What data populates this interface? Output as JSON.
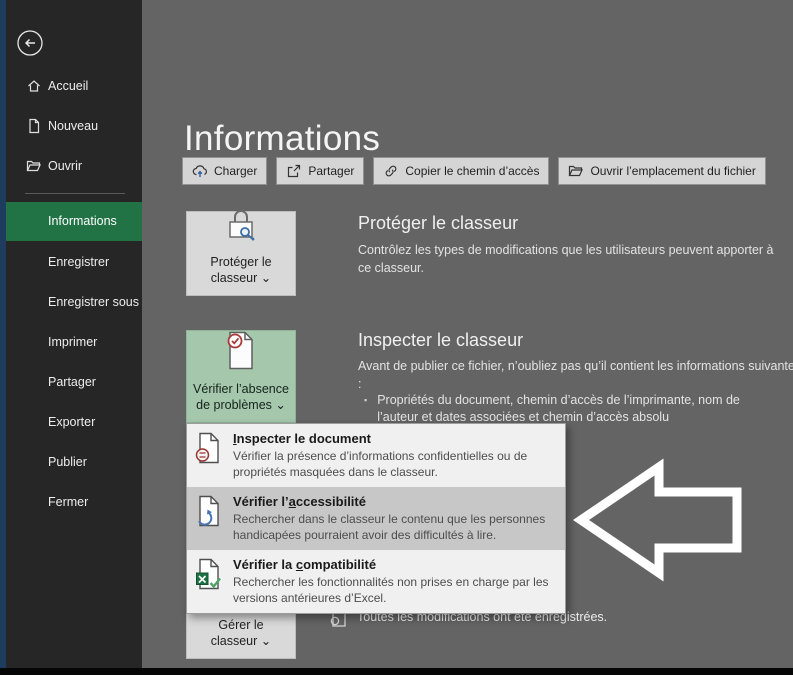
{
  "sidebar": {
    "top_items": [
      {
        "label": "Accueil"
      },
      {
        "label": "Nouveau"
      },
      {
        "label": "Ouvrir"
      }
    ],
    "menu_items": [
      {
        "label": "Informations",
        "active": true
      },
      {
        "label": "Enregistrer"
      },
      {
        "label": "Enregistrer sous"
      },
      {
        "label": "Imprimer"
      },
      {
        "label": "Partager"
      },
      {
        "label": "Exporter"
      },
      {
        "label": "Publier"
      },
      {
        "label": "Fermer"
      }
    ]
  },
  "main": {
    "title": "Informations",
    "toolbar": {
      "charger": "Charger",
      "partager": "Partager",
      "copier": "Copier le chemin d’accès",
      "ouvrir": "Ouvrir l’emplacement du fichier"
    },
    "protect": {
      "button_line1": "Protéger le",
      "button_line2": "classeur ⌄",
      "heading": "Protéger le classeur",
      "description": "Contrôlez les types de modifications que les utilisateurs peuvent apporter à ce classeur."
    },
    "inspect": {
      "button_line1": "Vérifier l’absence",
      "button_line2": "de problèmes ⌄",
      "heading": "Inspecter le classeur",
      "description": "Avant de publier ce fichier, n’oubliez pas qu’il contient les informations suivantes :",
      "bullet_marker": "▪",
      "bullet": "Propriétés du document, chemin d’accès de l’imprimante, nom de l’auteur et dates associées et chemin d’accès absolu"
    },
    "manage": {
      "button_line1": "Gérer le",
      "button_line2": "classeur ⌄",
      "status": "Toutes les modifications ont été enregistrées."
    }
  },
  "menu": {
    "items": [
      {
        "title_pre": "",
        "title_accel": "I",
        "title_post": "nspecter le document",
        "description": "Vérifier la présence d’informations confidentielles ou de propriétés masquées dans le classeur.",
        "icon": "inspect-document-icon",
        "highlighted": false
      },
      {
        "title_pre": "Vérifier l’",
        "title_accel": "a",
        "title_post": "ccessibilité",
        "description": "Rechercher dans le classeur le contenu que les personnes handicapées pourraient avoir des difficultés à lire.",
        "icon": "accessibility-checker-icon",
        "highlighted": true
      },
      {
        "title_pre": "Vérifier la ",
        "title_accel": "c",
        "title_post": "ompatibilité",
        "description": "Rechercher les fonctionnalités non prises en charge par les versions antérieures d’Excel.",
        "icon": "compatibility-checker-icon",
        "highlighted": false
      }
    ]
  },
  "colors": {
    "accent_green": "#217346",
    "sidebar_bg": "#262626",
    "main_bg": "#646464",
    "menu_highlight": "#c7c7c7",
    "inspect_button_bg": "#a5c8ad",
    "callout_arrow": "#ffffff"
  }
}
